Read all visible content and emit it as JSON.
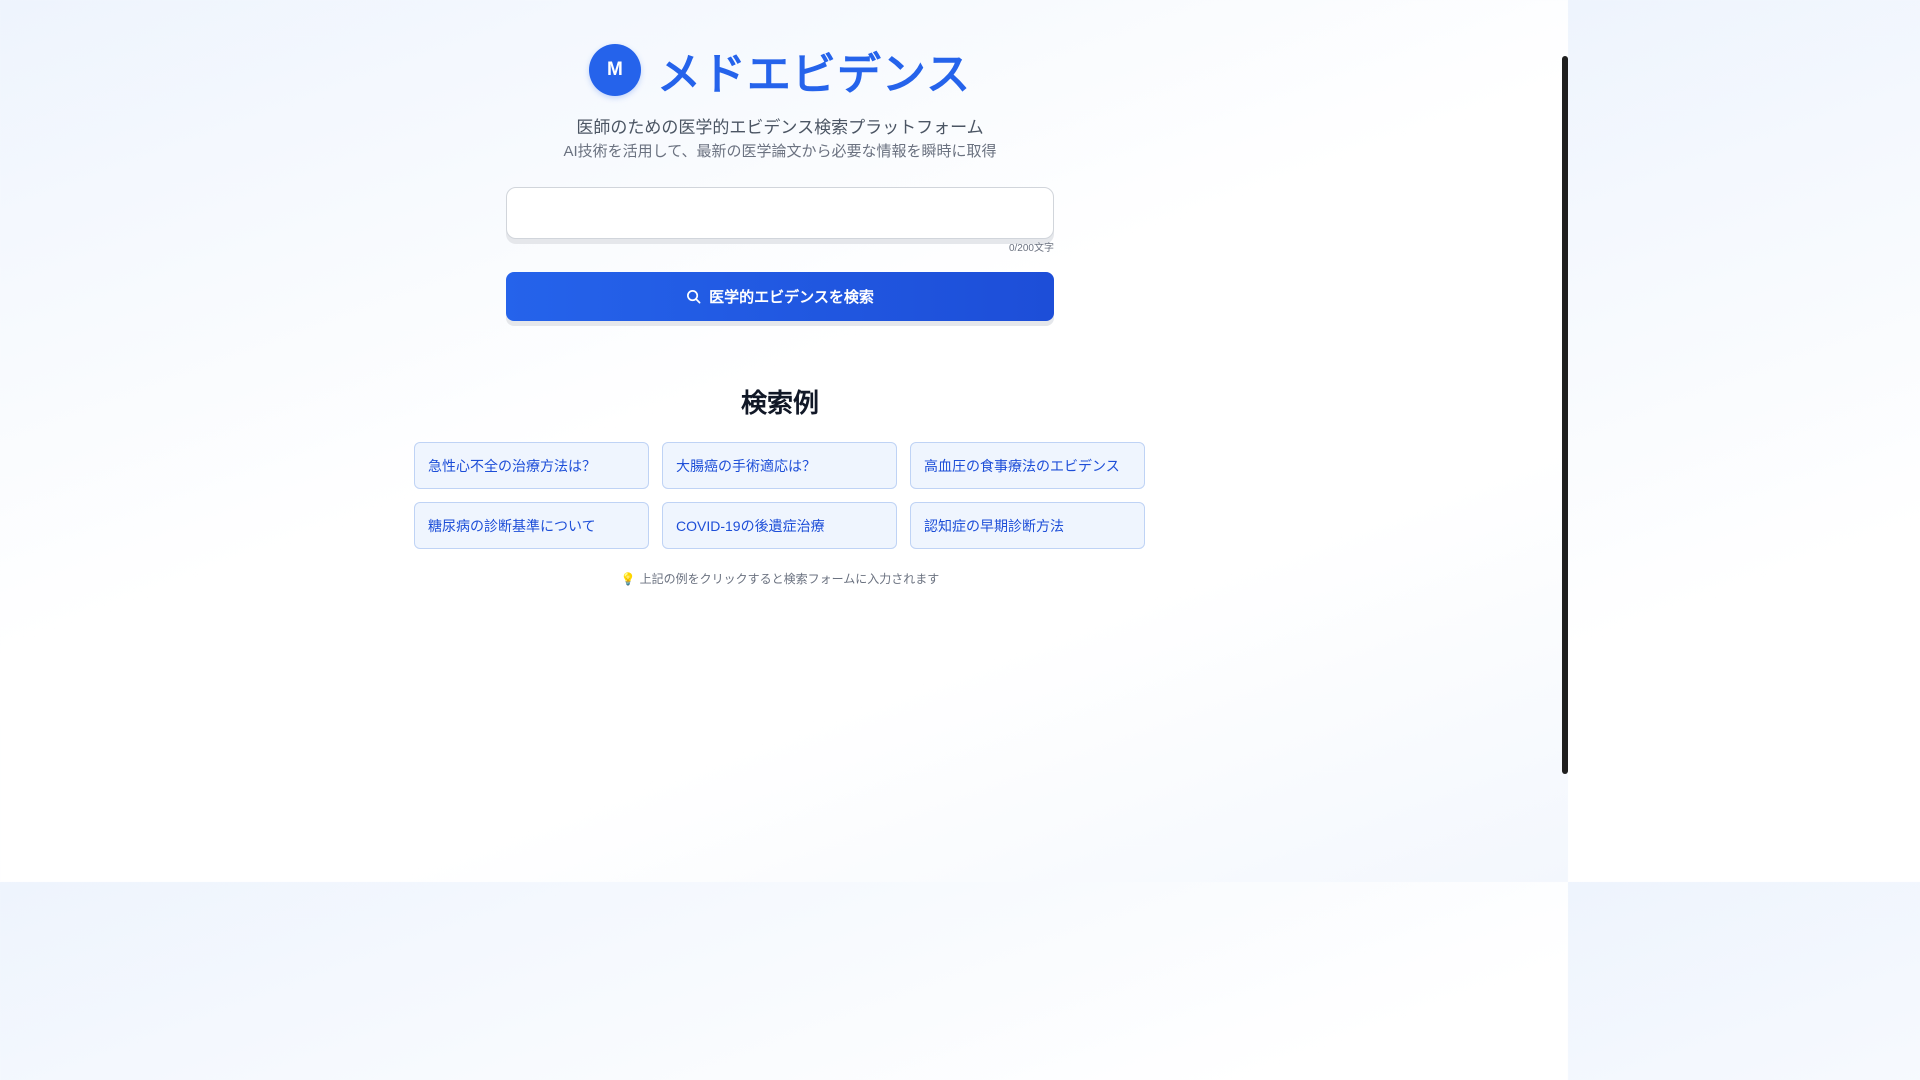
{
  "header": {
    "logo_letter": "M",
    "title": "メドエビデンス"
  },
  "tagline": "医師のための医学的エビデンス検索プラットフォーム",
  "subtagline": "AI技術を活用して、最新の医学論文から必要な情報を瞬時に取得",
  "search": {
    "value": "",
    "char_count": "0/200文字",
    "button_label": "医学的エビデンスを検索",
    "icon": "search-icon"
  },
  "examples": {
    "heading": "検索例",
    "items": [
      {
        "label": "急性心不全の治療方法は？"
      },
      {
        "label": "大腸癌の手術適応は？"
      },
      {
        "label": "高血圧の食事療法のエビデンス"
      },
      {
        "label": "糖尿病の診断基準について"
      },
      {
        "label": "COVID-19の後遺症治療"
      },
      {
        "label": "認知症の早期診断方法"
      }
    ],
    "hint_icon": "💡",
    "hint": "上記の例をクリックすると検索フォームに入力されます"
  },
  "colors": {
    "accent": "#2563eb",
    "card_bg": "#eff5fe",
    "card_border": "#bfd3f5"
  }
}
